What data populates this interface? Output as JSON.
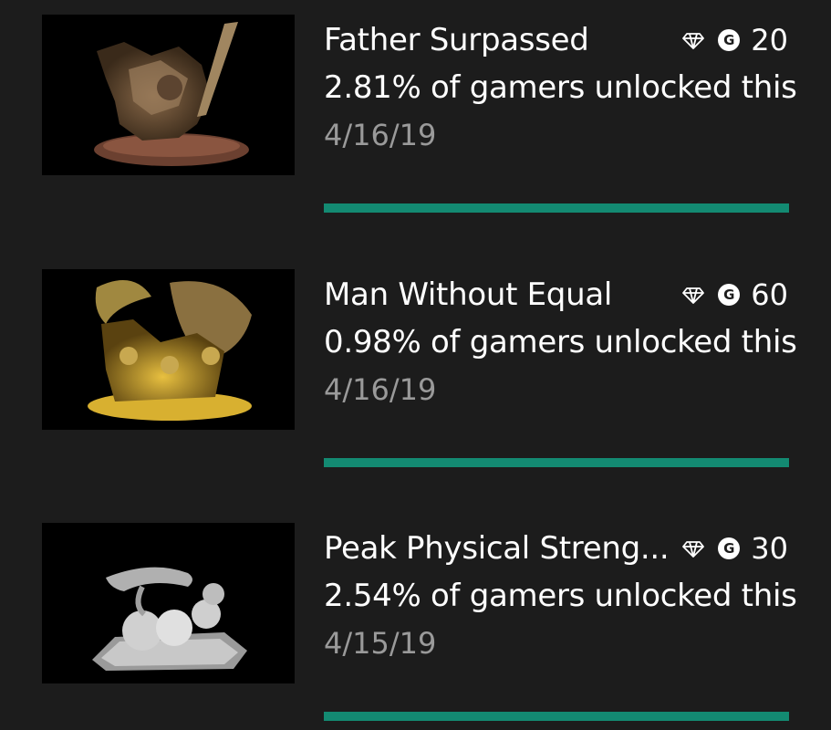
{
  "achievements": [
    {
      "title": "Father Surpassed",
      "rarity": "2.81% of gamers unlocked this",
      "date": "4/16/19",
      "gamerscore": "20",
      "score_badge": "G",
      "icons": [
        "diamond-icon",
        "gamerscore-icon"
      ],
      "image": "samurai-statue-art",
      "progress": 1.0
    },
    {
      "title": "Man Without Equal",
      "rarity": "0.98% of gamers unlocked this",
      "date": "4/16/19",
      "gamerscore": "60",
      "score_badge": "G",
      "icons": [
        "diamond-icon",
        "gamerscore-icon"
      ],
      "image": "dragon-and-warriors-art",
      "progress": 1.0
    },
    {
      "title": "Peak Physical Streng...",
      "rarity": "2.54% of gamers unlocked this",
      "date": "4/15/19",
      "gamerscore": "30",
      "score_badge": "G",
      "icons": [
        "diamond-icon",
        "gamerscore-icon"
      ],
      "image": "prayer-beads-art",
      "progress": 1.0
    }
  ],
  "colors": {
    "background": "#1c1c1c",
    "progress": "#138a72",
    "date_text": "#9a9a9a"
  }
}
